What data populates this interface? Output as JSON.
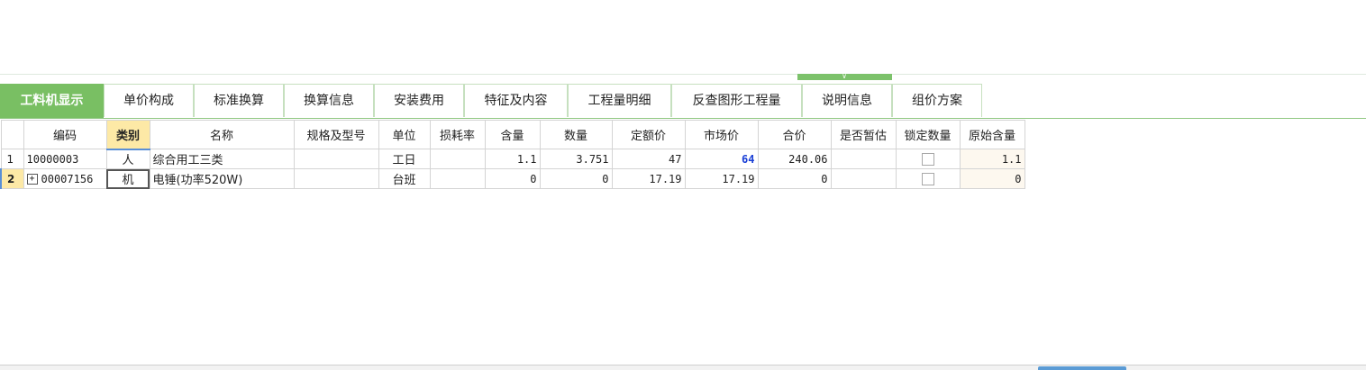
{
  "tabs": [
    {
      "label": "工料机显示",
      "active": true
    },
    {
      "label": "单价构成"
    },
    {
      "label": "标准换算"
    },
    {
      "label": "换算信息"
    },
    {
      "label": "安装费用"
    },
    {
      "label": "特征及内容"
    },
    {
      "label": "工程量明细"
    },
    {
      "label": "反查图形工程量"
    },
    {
      "label": "说明信息"
    },
    {
      "label": "组价方案"
    }
  ],
  "splitter": {
    "icon": "chevron-down-icon"
  },
  "columns": [
    "编码",
    "类别",
    "名称",
    "规格及型号",
    "单位",
    "损耗率",
    "含量",
    "数量",
    "定额价",
    "市场价",
    "合价",
    "是否暂估",
    "锁定数量",
    "原始含量"
  ],
  "rows": [
    {
      "no": "1",
      "code": "10000003",
      "category": "人",
      "name": "综合用工三类",
      "spec": "",
      "unit": "工日",
      "loss": "",
      "content": "1.1",
      "qty": "3.751",
      "quota_price": "47",
      "market_price": "64",
      "total": "240.06",
      "provisional": "",
      "orig_content": "1.1"
    },
    {
      "no": "2",
      "expander": "+",
      "code": "00007156",
      "category": "机",
      "name": "电锤(功率520W)",
      "spec": "",
      "unit": "台班",
      "loss": "",
      "content": "0",
      "qty": "0",
      "quota_price": "17.19",
      "market_price": "17.19",
      "total": "0",
      "provisional": "",
      "orig_content": "0"
    }
  ],
  "colors": {
    "tab_active": "#79bf63",
    "header_sorted": "#fde9a6",
    "market_highlight": "#1a3fd6"
  }
}
